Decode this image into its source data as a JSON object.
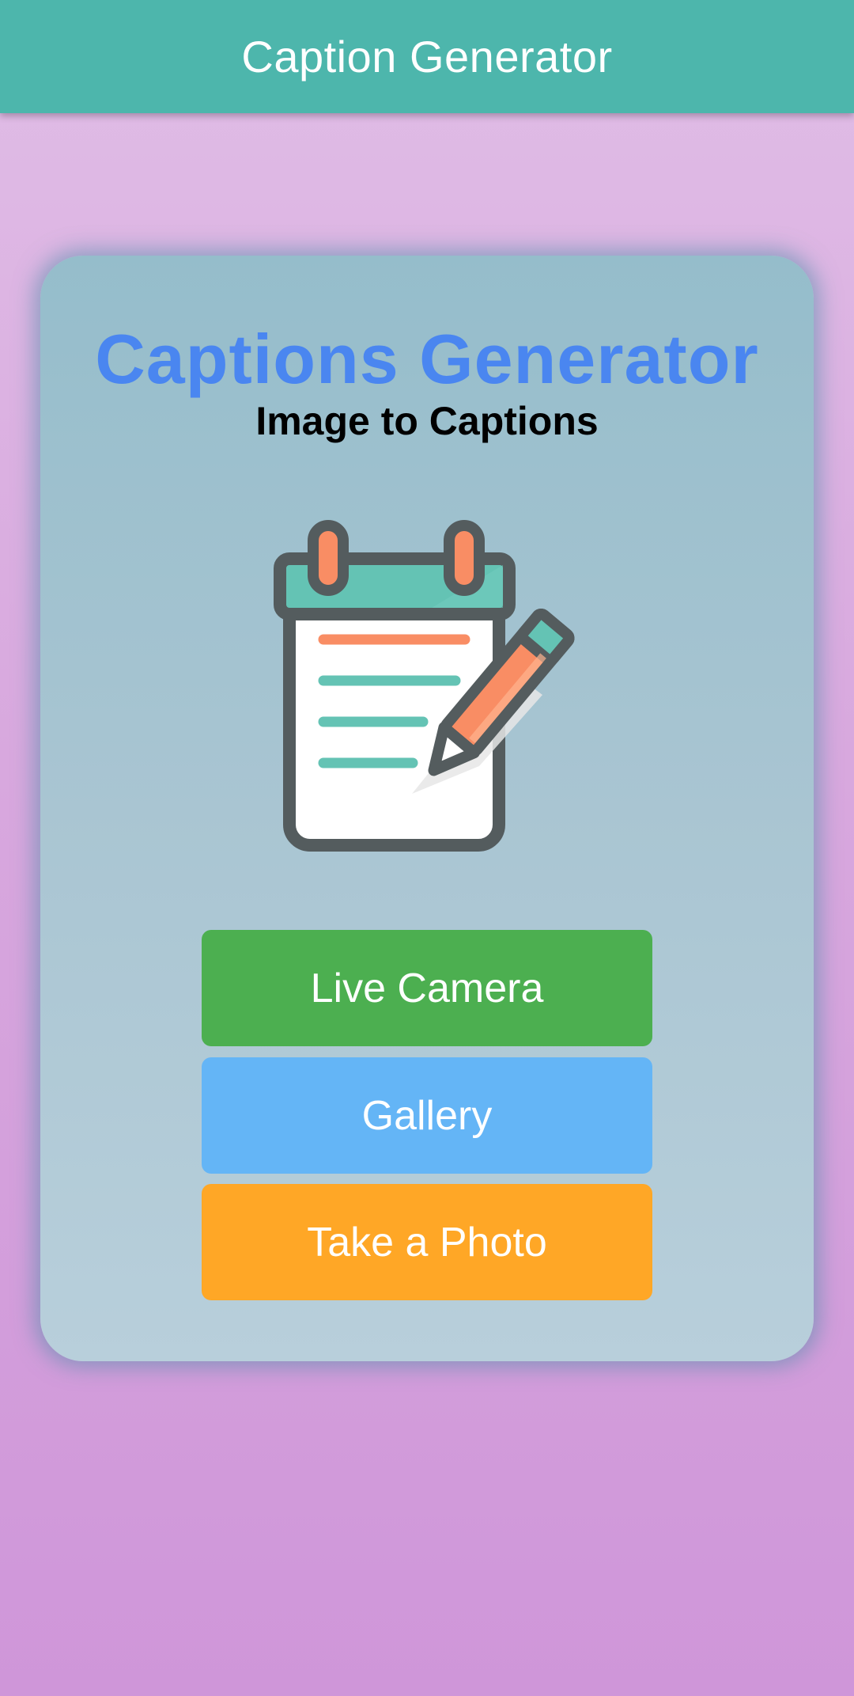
{
  "app_bar": {
    "title": "Caption Generator"
  },
  "card": {
    "title": "Captions Generator",
    "subtitle": "Image to Captions",
    "illustration_icon": "notepad-pencil-icon"
  },
  "buttons": {
    "live_camera": "Live Camera",
    "gallery": "Gallery",
    "take_photo": "Take a Photo"
  },
  "colors": {
    "app_bar": "#4db6ac",
    "title": "#4a86f0",
    "live_camera": "#4caf50",
    "gallery": "#64b5f6",
    "take_photo": "#ffa726"
  }
}
